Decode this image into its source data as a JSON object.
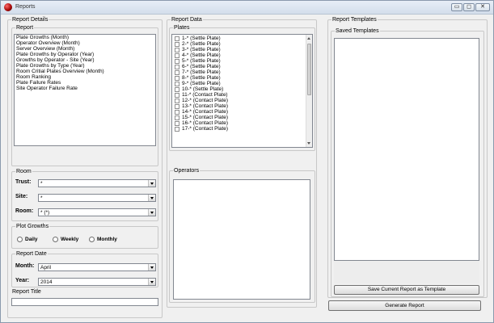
{
  "window": {
    "title": "Reports",
    "buttons": [
      "▭",
      "◻",
      "✕"
    ]
  },
  "report_details": {
    "legend": "Report Details",
    "report_group": {
      "legend": "Report",
      "items": [
        "Plate Growths (Month)",
        "Operator Overview (Month)",
        "Server Overview (Month)",
        "Plate Growths by Operator (Year)",
        "Growths by Operator - Site (Year)",
        "Plate Growths by Type (Year)",
        "Room Critial Plates Overview (Month)",
        "Room Ranking",
        "Plate Failure Rates",
        "Site Operator Failure Rate"
      ]
    },
    "room_group": {
      "legend": "Room",
      "trust_label": "Trust:",
      "trust_value": "*",
      "site_label": "Site:",
      "site_value": "*",
      "room_label": "Room:",
      "room_value": "* (*)"
    },
    "plot_growths": {
      "legend": "Plot Growths",
      "options": [
        "Daily",
        "Weekly",
        "Monthly"
      ]
    },
    "report_date": {
      "legend": "Report Date",
      "month_label": "Month:",
      "month_value": "April",
      "year_label": "Year:",
      "year_value": "2014"
    },
    "report_title": {
      "legend": "Report Title",
      "value": ""
    }
  },
  "report_data": {
    "legend": "Report Data",
    "plates": {
      "legend": "Plates",
      "items": [
        "1-* (Settle Plate)",
        "2-* (Settle Plate)",
        "3-* (Settle Plate)",
        "4-* (Settle Plate)",
        "5-* (Settle Plate)",
        "6-* (Settle Plate)",
        "7-* (Settle Plate)",
        "8-* (Settle Plate)",
        "9-* (Settle Plate)",
        "10-* (Settle Plate)",
        "11-* (Contact Plate)",
        "12-* (Contact Plate)",
        "13-* (Contact Plate)",
        "14-* (Contact Plate)",
        "15-* (Contact Plate)",
        "16-* (Contact Plate)",
        "17-* (Contact Plate)"
      ]
    },
    "operators": {
      "legend": "Operators",
      "items": []
    }
  },
  "report_templates": {
    "legend": "Report Templates",
    "saved_templates": {
      "legend": "Saved Templates",
      "items": []
    },
    "save_button": "Save Current Report as Template"
  },
  "generate_button": "Generate Report",
  "colors": {
    "window_bg": "#f0f0f0",
    "titlebar_top": "#e7eef7",
    "titlebar_bottom": "#d3deeb"
  }
}
